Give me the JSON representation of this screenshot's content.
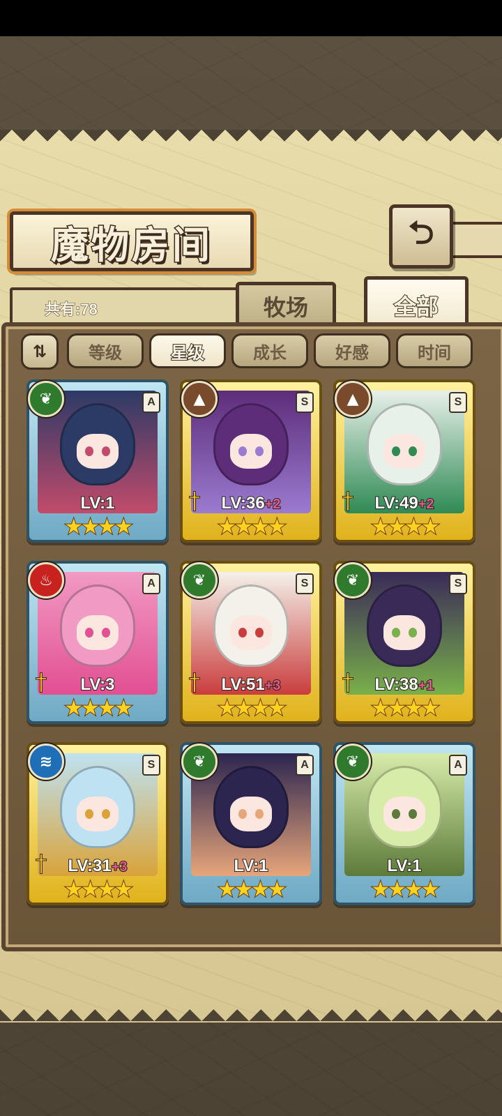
{
  "header": {
    "title": "魔物房间",
    "back_icon": "return-arrow-icon"
  },
  "collection": {
    "count_label": "共有:78"
  },
  "tabs": [
    {
      "label": "牧场",
      "selected": false
    },
    {
      "label": "全部",
      "selected": true
    }
  ],
  "sort": {
    "toggle_label": "⇅",
    "options": [
      {
        "label": "等级",
        "active": false
      },
      {
        "label": "星级",
        "active": true
      },
      {
        "label": "成长",
        "active": false
      },
      {
        "label": "好感",
        "active": false
      },
      {
        "label": "时间",
        "active": false
      }
    ]
  },
  "monsters": [
    {
      "element": "nature",
      "element_icon": "leaf-icon",
      "rank": "A",
      "level": "LV:1",
      "bonus": "",
      "stars": "★★★★",
      "weapon": false,
      "palette": "#2c3a66",
      "accent": "#c24b6b"
    },
    {
      "element": "earth",
      "element_icon": "mountain-icon",
      "rank": "S",
      "level": "LV:36",
      "bonus": "+2",
      "stars": "★★★★",
      "weapon": true,
      "palette": "#5d2d7a",
      "accent": "#9b7bd0"
    },
    {
      "element": "earth",
      "element_icon": "mountain-icon",
      "rank": "S",
      "level": "LV:49",
      "bonus": "+2",
      "stars": "★★★★",
      "weapon": true,
      "palette": "#e8f0ea",
      "accent": "#2f8a54"
    },
    {
      "element": "fire",
      "element_icon": "flame-icon",
      "rank": "A",
      "level": "LV:3",
      "bonus": "",
      "stars": "★★★★",
      "weapon": true,
      "palette": "#f19ac4",
      "accent": "#e24f92"
    },
    {
      "element": "nature",
      "element_icon": "leaf-icon",
      "rank": "S",
      "level": "LV:51",
      "bonus": "+3",
      "stars": "★★★★",
      "weapon": true,
      "palette": "#f4f1ea",
      "accent": "#c93d3d"
    },
    {
      "element": "nature",
      "element_icon": "leaf-icon",
      "rank": "S",
      "level": "LV:38",
      "bonus": "+1",
      "stars": "★★★★",
      "weapon": true,
      "palette": "#3a2a58",
      "accent": "#79b04a"
    },
    {
      "element": "water",
      "element_icon": "water-icon",
      "rank": "S",
      "level": "LV:31",
      "bonus": "+3",
      "stars": "★★★★",
      "weapon": true,
      "palette": "#bfe2f2",
      "accent": "#d9a33a"
    },
    {
      "element": "nature",
      "element_icon": "leaf-icon",
      "rank": "A",
      "level": "LV:1",
      "bonus": "",
      "stars": "★★★★",
      "weapon": false,
      "palette": "#2b2550",
      "accent": "#e7a57a"
    },
    {
      "element": "nature",
      "element_icon": "leaf-icon",
      "rank": "A",
      "level": "LV:1",
      "bonus": "",
      "stars": "★★★★",
      "weapon": false,
      "palette": "#d8ecaa",
      "accent": "#5c7a3a"
    }
  ],
  "element_colors": {
    "nature": "#2f7a2c",
    "earth": "#7a4a2c",
    "fire": "#c8221e",
    "water": "#1f6fb8"
  }
}
